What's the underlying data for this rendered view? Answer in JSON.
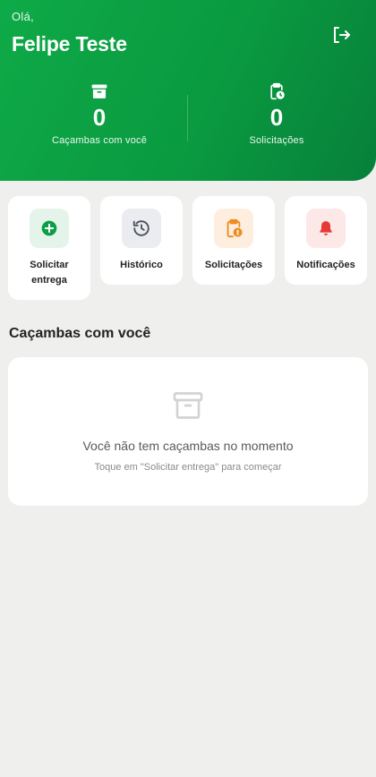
{
  "header": {
    "greeting": "Olá,",
    "user_name": "Felipe Teste",
    "stats": [
      {
        "value": "0",
        "label": "Caçambas com você",
        "icon": "archive-box-icon"
      },
      {
        "value": "0",
        "label": "Solicitações",
        "icon": "clipboard-clock-icon"
      }
    ]
  },
  "actions": [
    {
      "label": "Solicitar entrega",
      "icon": "plus-circle-icon",
      "color": "#0a9f45"
    },
    {
      "label": "Histórico",
      "icon": "history-icon",
      "color": "#5b6270"
    },
    {
      "label": "Solicitações",
      "icon": "clipboard-alert-icon",
      "color": "#f08c1e"
    },
    {
      "label": "Notificações",
      "icon": "bell-icon",
      "color": "#e53935"
    }
  ],
  "section": {
    "title": "Caçambas com você"
  },
  "empty_state": {
    "title": "Você não tem caçambas no momento",
    "hint": "Toque em \"Solicitar entrega\" para começar",
    "icon": "archive-box-icon"
  },
  "colors": {
    "brand_green": "#0a9a40",
    "background": "#eff0ee"
  }
}
